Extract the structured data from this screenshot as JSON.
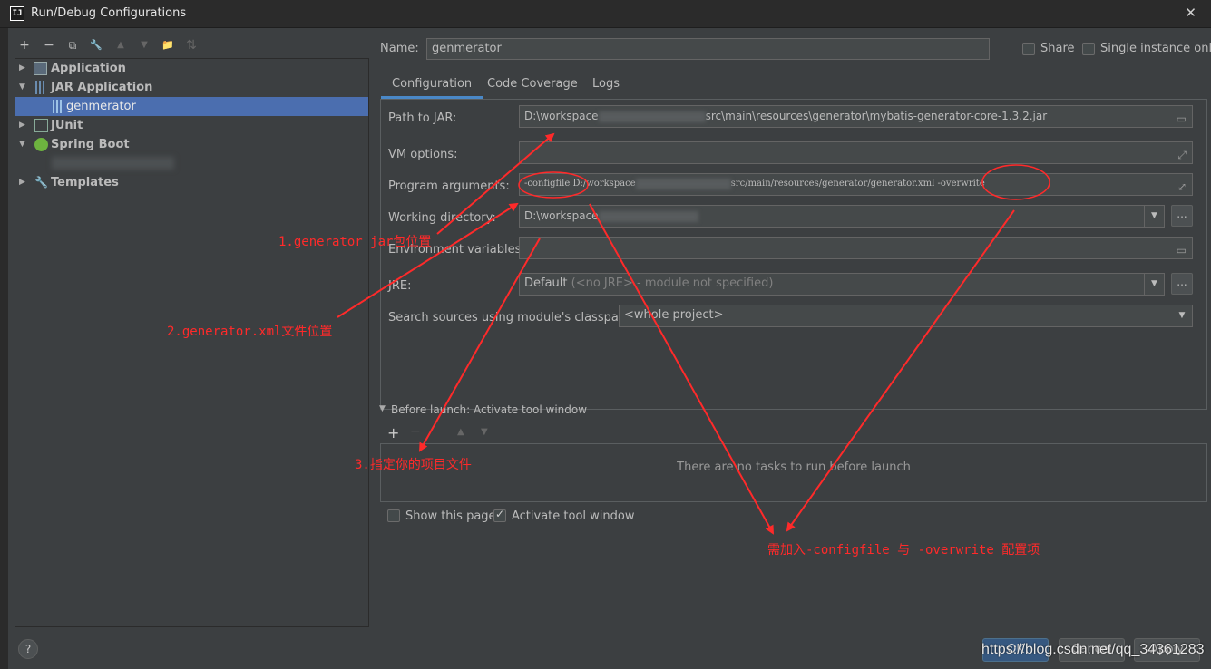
{
  "window": {
    "title": "Run/Debug Configurations",
    "app_icon_text": "IJ",
    "close_glyph": "✕"
  },
  "toolbar": {
    "add": "+",
    "remove": "−",
    "copy": "⧉",
    "edit": "🔧",
    "up": "▲",
    "down": "▼",
    "folder": "📁",
    "sort": "⇅"
  },
  "tree": {
    "items": [
      {
        "label": "Application",
        "arrow": "▶",
        "bold": true
      },
      {
        "label": "JAR Application",
        "arrow": "▼",
        "bold": true
      },
      {
        "label": "genmerator",
        "selected": true
      },
      {
        "label": "JUnit",
        "arrow": "▶",
        "bold": true
      },
      {
        "label": "Spring Boot",
        "arrow": "▼",
        "bold": true
      },
      {
        "label": "Templates",
        "arrow": "▶",
        "bold": true
      }
    ]
  },
  "config": {
    "name_label": "Name:",
    "name_value": "genmerator",
    "share_label": "Share",
    "share_checked": false,
    "single_instance_label": "Single instance only",
    "single_instance_checked": false,
    "tabs": [
      "Configuration",
      "Code Coverage",
      "Logs"
    ],
    "active_tab": "Configuration",
    "path_to_jar_label": "Path to JAR:",
    "path_to_jar_prefix": "D:\\workspace",
    "path_to_jar_suffix": "src\\main\\resources\\generator\\mybatis-generator-core-1.3.2.jar",
    "vm_options_label": "VM options:",
    "vm_options_value": "",
    "program_arguments_label": "Program arguments:",
    "program_arguments_prefix": "-configfile D:/workspace",
    "program_arguments_suffix": "src/main/resources/generator/generator.xml -overwrite",
    "working_directory_label": "Working directory:",
    "working_directory_value": "D:\\workspace",
    "env_variables_label": "Environment variables:",
    "env_variables_value": "",
    "jre_label": "JRE:",
    "jre_value_main": "Default",
    "jre_value_hint": "(<no JRE> - module not specified)",
    "search_sources_label": "Search sources using module's classpath:",
    "search_sources_value": "<whole project>",
    "dots": "...",
    "before_launch_label": "Before launch: Activate tool window",
    "no_tasks_text": "There are no tasks to run before launch",
    "show_page_label": "Show this page",
    "show_page_checked": false,
    "activate_tool_label": "Activate tool window",
    "activate_tool_checked": true
  },
  "buttons": {
    "ok": "OK",
    "cancel": "Cancel",
    "apply": "Apply",
    "help": "?"
  },
  "annotations": {
    "a1": "1.generator jar包位置",
    "a2": "2.generator.xml文件位置",
    "a3": "3.指定你的项目文件",
    "a4": "需加入-configfile 与 -overwrite 配置项",
    "color": "#ff2a2a"
  },
  "watermark": "https://blog.csdn.net/qq_34361283"
}
